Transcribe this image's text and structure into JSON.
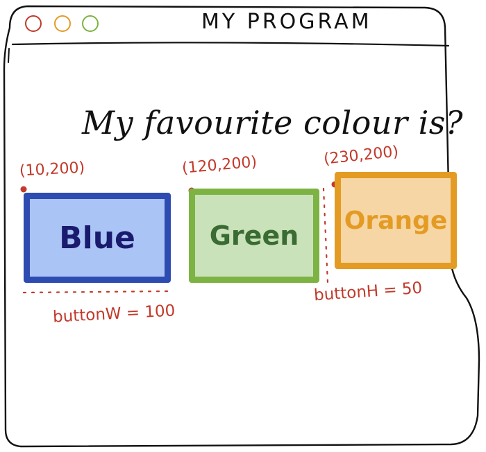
{
  "window": {
    "title": "MY PROGRAM",
    "controls": [
      {
        "name": "close",
        "color": "#c0392b"
      },
      {
        "name": "minimize",
        "color": "#e39b26"
      },
      {
        "name": "maximize",
        "color": "#7cb342"
      }
    ]
  },
  "main": {
    "question": "My favourite colour is?",
    "buttons": [
      {
        "label": "Blue",
        "fill": "#aac4f5",
        "border": "#2d4bb0",
        "text_color": "#1a1a6e"
      },
      {
        "label": "Green",
        "fill": "#c9e2ba",
        "border": "#7cb342",
        "text_color": "#3a6b32"
      },
      {
        "label": "Orange",
        "fill": "#f6d6a4",
        "border": "#e49b23",
        "text_color": "#e49b23"
      }
    ]
  },
  "annotations": {
    "coord_blue": "(10,200)",
    "coord_green": "(120,200)",
    "coord_orange": "(230,200)",
    "button_width": "buttonW = 100",
    "button_height": "buttonH = 50",
    "color": "#c23a2b"
  }
}
